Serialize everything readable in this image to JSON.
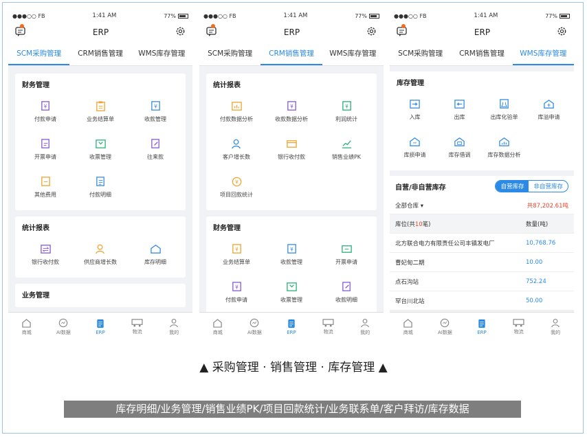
{
  "status": {
    "carrier": "●●●○○ FB",
    "time": "1:41 AM",
    "battery": "77%"
  },
  "app_title": "ERP",
  "tabs": [
    "SCM采购管理",
    "CRM销售管理",
    "WMS库存管理"
  ],
  "bottom_nav": [
    "商城",
    "AI数据",
    "ERP",
    "物流",
    "我的"
  ],
  "phone1": {
    "sections": [
      {
        "title": "财务管理",
        "items": [
          "付款申请",
          "业务结算单",
          "收款管理",
          "开票申请",
          "收票管理",
          "往来款",
          "其他费用",
          "付款明细"
        ]
      },
      {
        "title": "统计报表",
        "items": [
          "银行收付款",
          "供应商增长数",
          "库存明细"
        ]
      },
      {
        "title": "业务管理",
        "items": []
      }
    ]
  },
  "phone2": {
    "sections": [
      {
        "title": "统计报表",
        "items": [
          "付款数据分析",
          "收款数据分析",
          "利润统计",
          "客户增长数",
          "银行收付款",
          "销售业绩PK",
          "项目回款统计"
        ]
      },
      {
        "title": "财务管理",
        "items": [
          "业务结算单",
          "收款管理",
          "开票申请",
          "付款申请",
          "收票管理",
          "收款明细"
        ]
      }
    ]
  },
  "phone3": {
    "section_title": "库存管理",
    "items": [
      "入库",
      "出库",
      "出库化验单",
      "库溢申请",
      "库损申请",
      "库存借调",
      "库存数据分析"
    ],
    "stock_title": "自营/非自营库存",
    "seg": [
      "自营库存",
      "非自营库存"
    ],
    "warehouse": "全部仓库 ▾",
    "total": "共87,202.61吨",
    "col1": "库位(共",
    "col1_count": "10",
    "col1_end": "笔)",
    "col2": "数量(吨)",
    "rows": [
      {
        "name": "北方联合电力有限责任公司丰镇发电厂",
        "qty": "10,768.76"
      },
      {
        "name": "曹妃甸二期",
        "qty": "10.00"
      },
      {
        "name": "点石沟站",
        "qty": "752.24"
      },
      {
        "name": "罕台川北站",
        "qty": "50.00"
      }
    ]
  },
  "caption": "▲ 采购管理 · 销售管理 · 库存管理 ▲",
  "banner": "库存明细/业务管理/销售业绩PK/项目回款统计/业务联系单/客户拜访/库存数据",
  "colors": {
    "accent": "#2a8ae6",
    "badge": "#f56a1c"
  }
}
